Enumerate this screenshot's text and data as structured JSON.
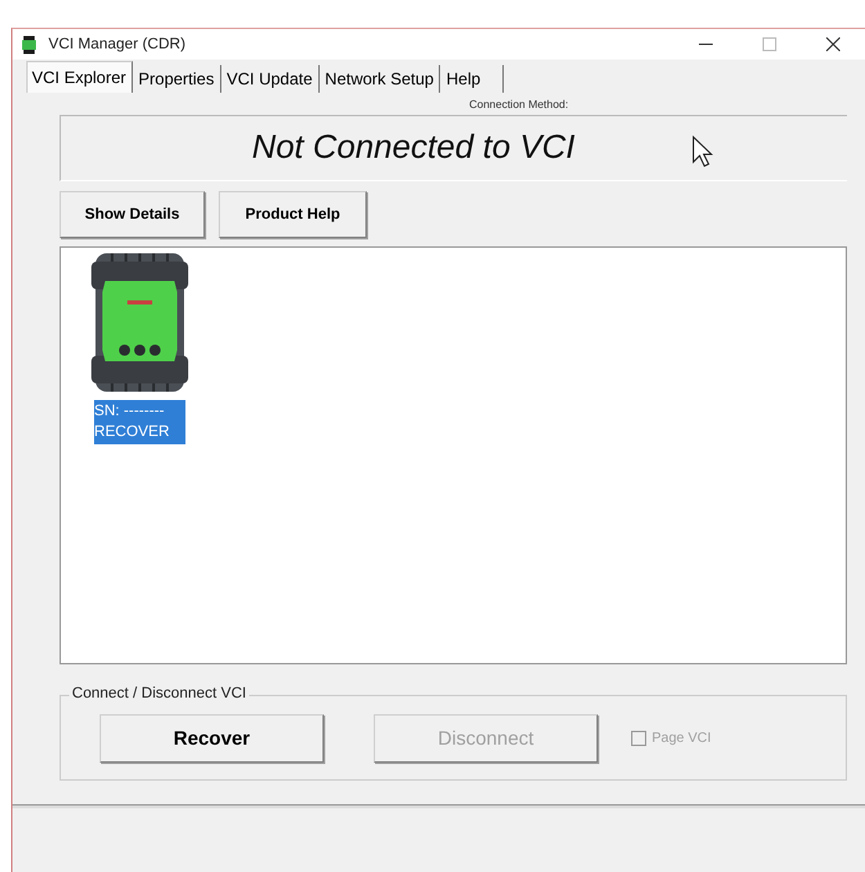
{
  "window": {
    "title": "VCI Manager (CDR)"
  },
  "tabs": [
    {
      "label": "VCI Explorer",
      "selected": true
    },
    {
      "label": "Properties",
      "selected": false
    },
    {
      "label": "VCI Update",
      "selected": false
    },
    {
      "label": "Network Setup",
      "selected": false
    },
    {
      "label": "Help",
      "selected": false
    }
  ],
  "connection": {
    "label": "Connection Method:",
    "status": "Not Connected to VCI"
  },
  "buttons": [
    {
      "label": "Show Details"
    },
    {
      "label": "Product Help"
    }
  ],
  "devices": [
    {
      "serial": "SN: --------",
      "name": "RECOVER",
      "selected": true
    }
  ],
  "connect_group": {
    "title": "Connect / Disconnect VCI",
    "buttons": [
      {
        "label": "Recover",
        "disabled": false
      },
      {
        "label": "Disconnect",
        "disabled": true
      }
    ],
    "checkbox": {
      "label": "Page VCI",
      "checked": false,
      "disabled": true
    }
  }
}
